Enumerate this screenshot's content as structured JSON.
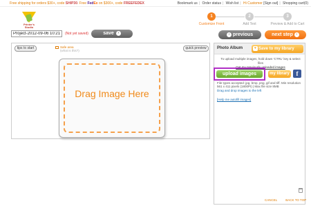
{
  "topbar": {
    "promo_text": "Free shipping for orders $30+, code",
    "code1": "SHIP30",
    "promo_mid": ". Free",
    "fed": "Fed",
    "ex": "Ex",
    "promo_after": "on $300+, code",
    "code2": "FREEFEDEX",
    "bookmark": "Bookmark us",
    "order_status": "Order status",
    "wish_list": "Wish list",
    "hi_customer": "Hi Customer",
    "sign_out": "[Sign out]",
    "cart": "Shopping cart(0)"
  },
  "logo": {
    "name": "Printer's Studio"
  },
  "steps": [
    {
      "num": "1",
      "label": "Customize Front",
      "state": "active"
    },
    {
      "num": "2",
      "label": "Add Text",
      "state": "inactive"
    },
    {
      "num": "3",
      "label": "Preview & Add to Cart",
      "state": "inactive"
    }
  ],
  "project": {
    "name_value": "Project-2012-09-06 10:21",
    "not_saved": "(Not yet saved)",
    "save_label": "save"
  },
  "nav": {
    "previous_label": "previous",
    "next_label": "next step"
  },
  "canvas": {
    "tips_label": "tips to start",
    "safe_area": "Safe area",
    "safe_sub": "(what is this?)",
    "quick_preview": "quick preview",
    "drop_text": "Drag Image Here"
  },
  "album": {
    "title": "Photo Album",
    "save_library": "Save to my library",
    "upload_hint": "To upload multiple images, hold down 'CTRL' key & select files",
    "get_previous": "Get my previously uploaded images",
    "upload_label": "upload images",
    "my_library": "my library",
    "fb_letter": "f",
    "file_types": "File types accepted: jpg, bmp, png, gif and tiff. Min resolution 561 x 411 pixels (1800PI) | Max file size 8MB",
    "drag_hint": "Drag and drop images to the left",
    "help_link": "[Help me autofill images]"
  },
  "footer": {
    "cancel": "CANCEL",
    "back_to_top": "BACK TO TOP"
  },
  "colors": {
    "accent": "#f58220",
    "upload_green": "#6aa82d",
    "highlight": "#b02fc5",
    "facebook": "#3b5998"
  }
}
